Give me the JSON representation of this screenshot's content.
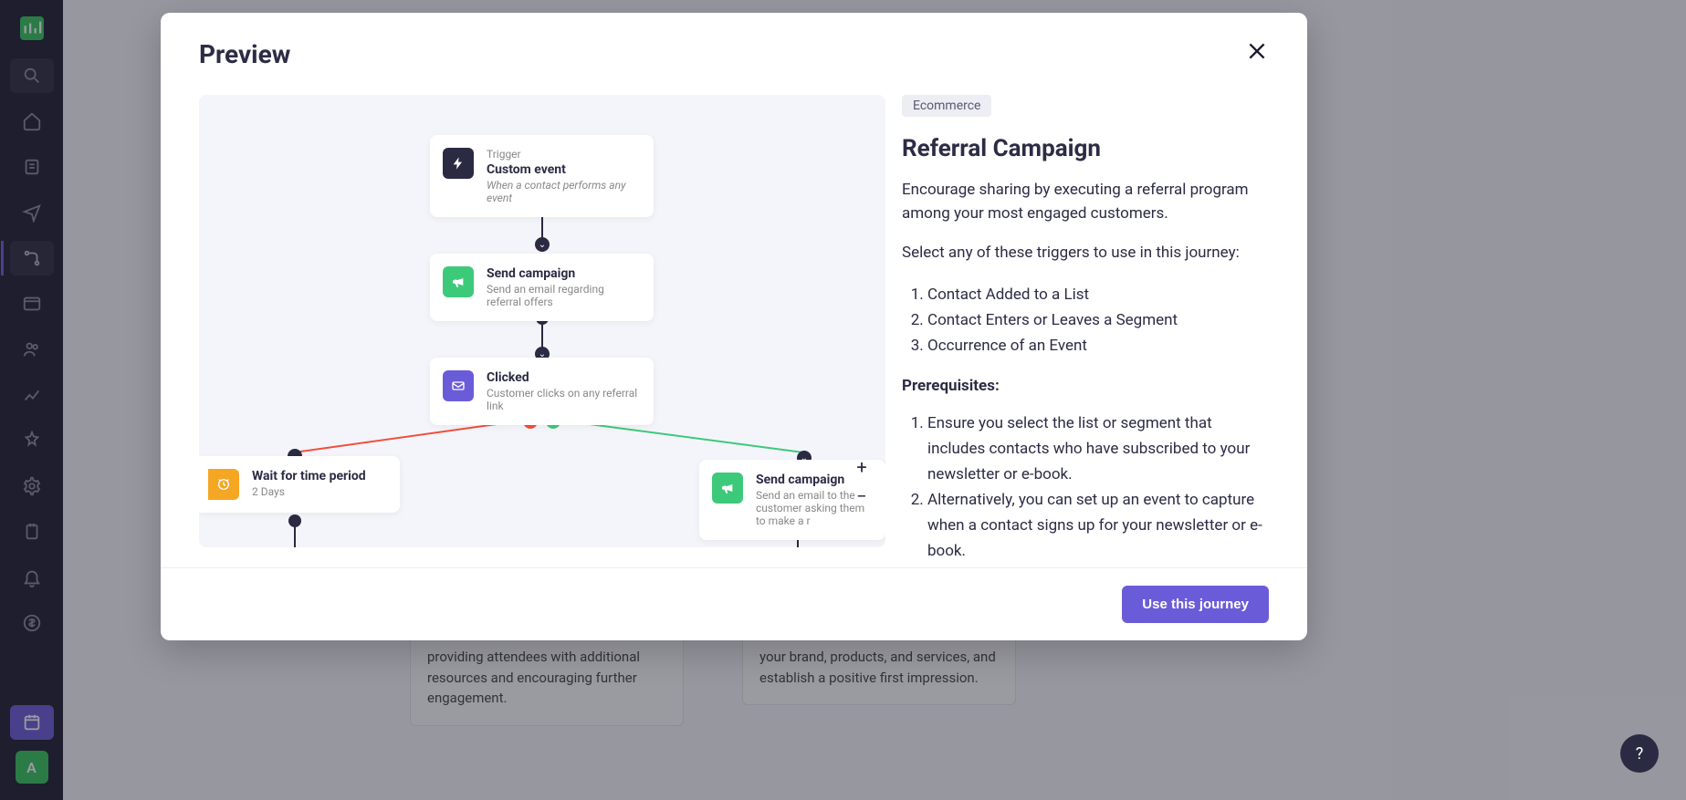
{
  "sidebar": {
    "avatar_letter": "A"
  },
  "bg_cards": {
    "card1": "providing attendees with additional resources and encouraging further engagement.",
    "card2": "your brand, products, and services, and establish a positive first impression."
  },
  "modal": {
    "title": "Preview",
    "cta": "Use this journey"
  },
  "details": {
    "tag": "Ecommerce",
    "heading": "Referral Campaign",
    "intro": "Encourage sharing by executing a referral program among your most engaged customers.",
    "trigger_intro": "Select any of these triggers to use in this journey:",
    "triggers": [
      "Contact Added to a List",
      "Contact Enters or Leaves a Segment",
      "Occurrence of an Event"
    ],
    "prereq_label": "Prerequisites:",
    "prereqs": [
      "Ensure you select the list or segment that includes contacts who have subscribed to your newsletter or e-book.",
      "Alternatively, you can set up an event to capture when a contact signs up for your newsletter or e-book."
    ]
  },
  "nodes": {
    "trigger": {
      "eyebrow": "Trigger",
      "title": "Custom event",
      "sub": "When a contact performs any event"
    },
    "send1": {
      "title": "Send campaign",
      "sub": "Send an email regarding referral offers"
    },
    "clicked": {
      "title": "Clicked",
      "sub": "Customer clicks on any referral link"
    },
    "wait": {
      "title": "Wait for time period",
      "sub": "2 Days"
    },
    "send2": {
      "title": "Send campaign",
      "sub": "Send an email to the customer asking them to make a r"
    }
  },
  "zoom": {
    "plus": "+",
    "minus": "−"
  }
}
